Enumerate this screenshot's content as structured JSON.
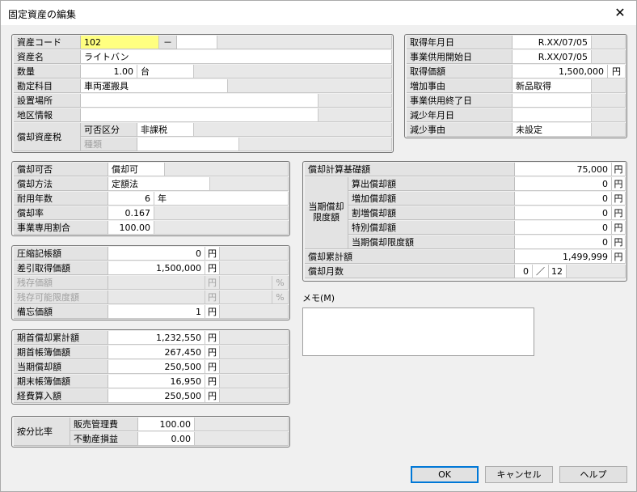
{
  "window": {
    "title": "固定資産の編集",
    "close_label": "✕"
  },
  "asset": {
    "code_label": "資産コード",
    "code": "102",
    "code_dash": "－",
    "code_sub": "",
    "name_label": "資産名",
    "name": "ライトバン",
    "qty_label": "数量",
    "qty": "1.00",
    "qty_unit": "台",
    "account_label": "勘定科目",
    "account": "車両運搬具",
    "location_label": "設置場所",
    "location": "",
    "region_label": "地区情報",
    "region": "",
    "tax_label": "償却資産税",
    "tax_class_label": "可否区分",
    "tax_class": "非課税",
    "tax_kind_label": "種類",
    "tax_kind": ""
  },
  "dates": {
    "acquired_label": "取得年月日",
    "acquired": "R.XX/07/05",
    "start_label": "事業供用開始日",
    "start": "R.XX/07/05",
    "price_label": "取得価額",
    "price": "1,500,000",
    "price_unit": "円",
    "increase_label": "増加事由",
    "increase": "新品取得",
    "end_label": "事業供用終了日",
    "end": "",
    "decrease_date_label": "減少年月日",
    "decrease_date": "",
    "decrease_reason_label": "減少事由",
    "decrease_reason": "未設定"
  },
  "depr": {
    "allowed_label": "償却可否",
    "allowed": "償却可",
    "method_label": "償却方法",
    "method": "定額法",
    "life_label": "耐用年数",
    "life": "6",
    "life_unit": "年",
    "rate_label": "償却率",
    "rate": "0.167",
    "business_label": "事業専用割合",
    "business": "100.00"
  },
  "values": {
    "compress_label": "圧縮記帳額",
    "compress": "0",
    "net_label": "差引取得価額",
    "net": "1,500,000",
    "residual_label": "残存価額",
    "residual": "",
    "residual_limit_label": "残存可能限度額",
    "residual_limit": "",
    "memo_value_label": "備忘価額",
    "memo_value": "1",
    "yen": "円",
    "pct": "%"
  },
  "period": {
    "begin_accum_label": "期首償却累計額",
    "begin_accum": "1,232,550",
    "begin_book_label": "期首帳簿価額",
    "begin_book": "267,450",
    "current_label": "当期償却額",
    "current": "250,500",
    "end_book_label": "期末帳簿価額",
    "end_book": "16,950",
    "expense_label": "経費算入額",
    "expense": "250,500",
    "yen": "円"
  },
  "ratio": {
    "label": "按分比率",
    "sales_label": "販売管理費",
    "sales": "100.00",
    "nonop_label": "不動産損益",
    "nonop": "0.00"
  },
  "calc": {
    "base_label": "償却計算基礎額",
    "base": "75,000",
    "limit_label": "当期償却限度額",
    "normal_label": "算出償却額",
    "normal": "0",
    "add_label": "増加償却額",
    "add": "0",
    "extra_label": "割増償却額",
    "extra": "0",
    "special_label": "特別償却額",
    "special": "0",
    "limit_total_label": "当期償却限度額",
    "limit_total": "0",
    "accum_label": "償却累計額",
    "accum": "1,499,999",
    "months_label": "償却月数",
    "months": "0",
    "months_sep": "／",
    "months_total": "12",
    "yen": "円"
  },
  "memo": {
    "label": "メモ(M)",
    "text": ""
  },
  "buttons": {
    "ok": "OK",
    "cancel": "キャンセル",
    "help": "ヘルプ"
  }
}
